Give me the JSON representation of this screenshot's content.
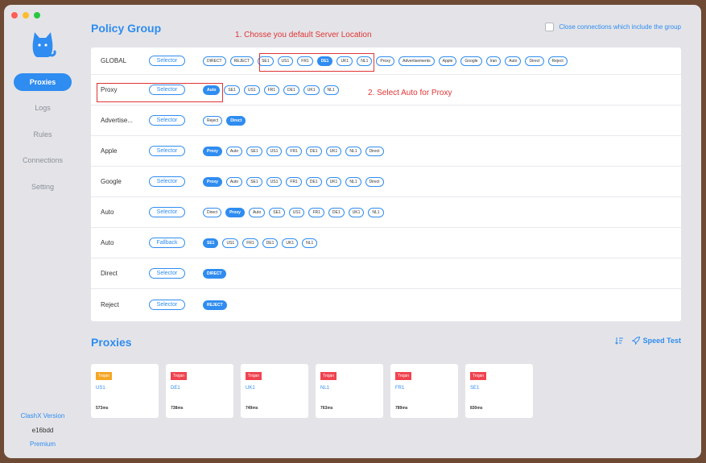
{
  "colors": {
    "accent": "#2f8cf0",
    "annotation": "#e03434",
    "badge_orange": "#f5a623",
    "badge_red": "#f0434f"
  },
  "window": {
    "traffic_lights": [
      "#ff5f57",
      "#febc2e",
      "#28c840"
    ]
  },
  "sidebar": {
    "logo_icon": "cat-icon",
    "items": [
      {
        "label": "Proxies",
        "active": true
      },
      {
        "label": "Logs",
        "active": false
      },
      {
        "label": "Rules",
        "active": false
      },
      {
        "label": "Connections",
        "active": false
      },
      {
        "label": "Setting",
        "active": false
      }
    ],
    "footer": {
      "version_label": "ClashX Version",
      "version": "e16bdd",
      "edition": "Premium"
    }
  },
  "policy": {
    "title": "Policy Group",
    "close_connections_label": "Close connections which include the group",
    "close_connections_checked": false,
    "groups": [
      {
        "name": "GLOBAL",
        "type": "Selector",
        "selected": "DE1",
        "options": [
          "DIRECT",
          "REJECT",
          "SE1",
          "US1",
          "FR1",
          "DE1",
          "UK1",
          "NL1",
          "Proxy",
          "Advertisements",
          "Apple",
          "Google",
          "Iran",
          "Auto",
          "Direct",
          "Reject"
        ]
      },
      {
        "name": "Proxy",
        "type": "Selector",
        "selected": "Auto",
        "options": [
          "Auto",
          "SE1",
          "US1",
          "FR1",
          "DE1",
          "UK1",
          "NL1"
        ]
      },
      {
        "name": "Advertise...",
        "type": "Selector",
        "selected": "Direct",
        "options": [
          "Reject",
          "Direct"
        ]
      },
      {
        "name": "Apple",
        "type": "Selector",
        "selected": "Proxy",
        "options": [
          "Proxy",
          "Auto",
          "SE1",
          "US1",
          "FR1",
          "DE1",
          "UK1",
          "NL1",
          "Direct"
        ]
      },
      {
        "name": "Google",
        "type": "Selector",
        "selected": "Proxy",
        "options": [
          "Proxy",
          "Auto",
          "SE1",
          "US1",
          "FR1",
          "DE1",
          "UK1",
          "NL1",
          "Direct"
        ]
      },
      {
        "name": "Auto",
        "type": "Selector",
        "selected": "Proxy",
        "options": [
          "Direct",
          "Proxy",
          "Auto",
          "SE1",
          "US1",
          "FR1",
          "DE1",
          "UK1",
          "NL1"
        ]
      },
      {
        "name": "Auto",
        "type": "Fallback",
        "selected": "SE1",
        "options": [
          "SE1",
          "US1",
          "FR1",
          "DE1",
          "UK1",
          "NL1"
        ]
      },
      {
        "name": "Direct",
        "type": "Selector",
        "selected": "DIRECT",
        "options": [
          "DIRECT"
        ]
      },
      {
        "name": "Reject",
        "type": "Selector",
        "selected": "REJECT",
        "options": [
          "REJECT"
        ]
      }
    ]
  },
  "annotations": {
    "note1": "1. Chosse you default Server Location",
    "note2": "2. Select Auto for Proxy"
  },
  "proxies": {
    "title": "Proxies",
    "sort_icon": "sort-icon",
    "speed_test_icon": "rocket-icon",
    "speed_test_label": "Speed Test",
    "cards": [
      {
        "badge": "Trojan",
        "badge_color": "#f5a623",
        "name": "US1",
        "delay": "573ms"
      },
      {
        "badge": "Trojan",
        "badge_color": "#f0434f",
        "name": "DE1",
        "delay": "738ms"
      },
      {
        "badge": "Trojan",
        "badge_color": "#f0434f",
        "name": "UK1",
        "delay": "749ms"
      },
      {
        "badge": "Trojan",
        "badge_color": "#f0434f",
        "name": "NL1",
        "delay": "763ms"
      },
      {
        "badge": "Trojan",
        "badge_color": "#f0434f",
        "name": "FR1",
        "delay": "789ms"
      },
      {
        "badge": "Trojan",
        "badge_color": "#f0434f",
        "name": "SE1",
        "delay": "830ms"
      }
    ]
  }
}
